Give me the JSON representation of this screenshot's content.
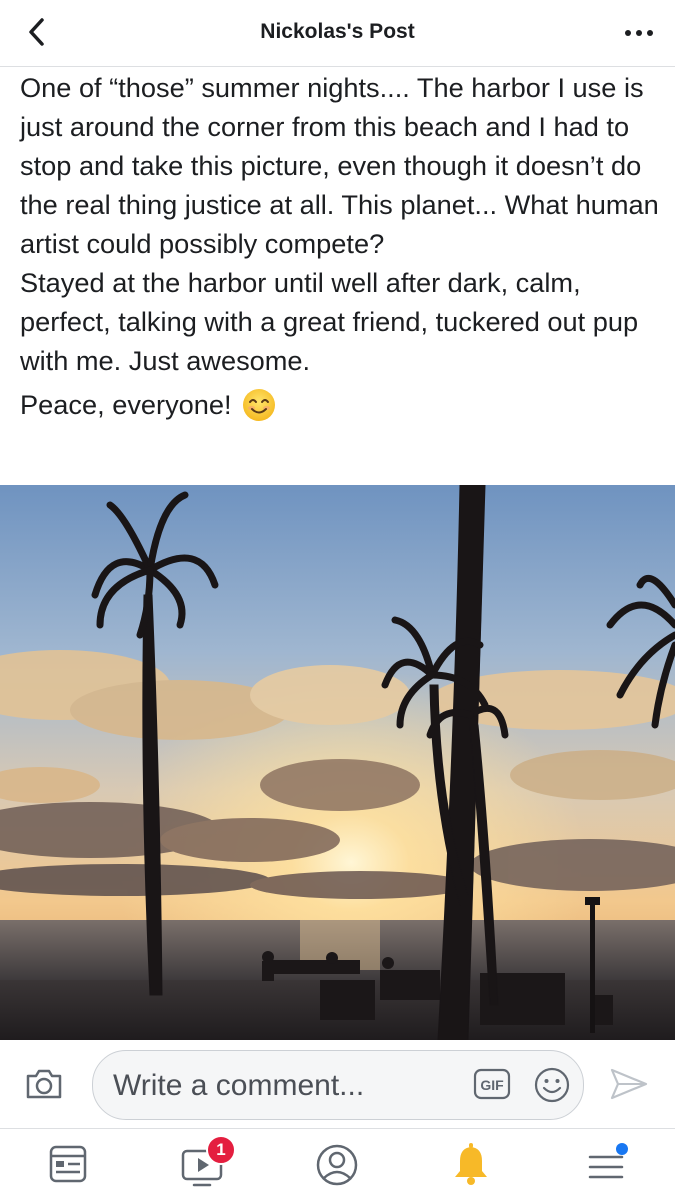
{
  "header": {
    "title": "Nickolas's Post",
    "back_icon": "chevron-left-icon",
    "more_icon": "more-horizontal-icon"
  },
  "post": {
    "paragraph1": "One of “those” summer nights.... The harbor I use is just around the corner from this beach and I had to stop and take this picture, even though it doesn’t do the real thing justice at all. This planet... What human artist could possibly compete?",
    "paragraph2": "Stayed at the harbor until well after dark, calm, perfect, talking with a great friend, tuckered out pup with me. Just awesome.",
    "paragraph3": "Peace, everyone!",
    "emoji": "smiling-face-icon"
  },
  "comment_bar": {
    "placeholder": "Write a comment...",
    "gif_label": "GIF"
  },
  "nav": {
    "tabs": [
      {
        "name": "news-feed",
        "icon": "news-feed-icon"
      },
      {
        "name": "watch",
        "icon": "video-icon",
        "badge": "1"
      },
      {
        "name": "profile",
        "icon": "profile-icon"
      },
      {
        "name": "notifications",
        "icon": "bell-icon"
      },
      {
        "name": "menu",
        "icon": "menu-icon"
      }
    ]
  },
  "colors": {
    "text": "#1c1e21",
    "icon_gray": "#606770",
    "badge_red": "#e41e3f",
    "bell_yellow": "#f7b928",
    "accent_blue": "#1877f2"
  }
}
